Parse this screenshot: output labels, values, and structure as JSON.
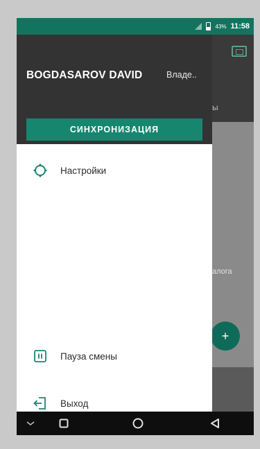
{
  "status_bar": {
    "battery_percent": "43%",
    "time": "11:58"
  },
  "drawer": {
    "user_name": "BOGDASAROV DAVID",
    "user_role": "Владе..",
    "sync_button_label": "СИНХРОНИЗАЦИЯ",
    "settings_label": "Настройки",
    "pause_shift_label": "Пауза смены",
    "logout_label": "Выход"
  },
  "background_app": {
    "tab_fragment": "ы",
    "dialog_fragment": "алога",
    "fab_symbol": "+"
  },
  "colors": {
    "accent": "#17866f",
    "status_bar": "#12745f",
    "drawer_header": "#333333"
  },
  "icons": {
    "signal": "signal-icon",
    "battery": "battery-icon",
    "settings": "gear-icon",
    "pause": "pause-icon",
    "logout": "logout-icon",
    "qr": "qr-scan-icon",
    "back": "back-icon",
    "home": "home-icon",
    "recents": "recents-icon",
    "collapse": "chevron-down-icon"
  }
}
